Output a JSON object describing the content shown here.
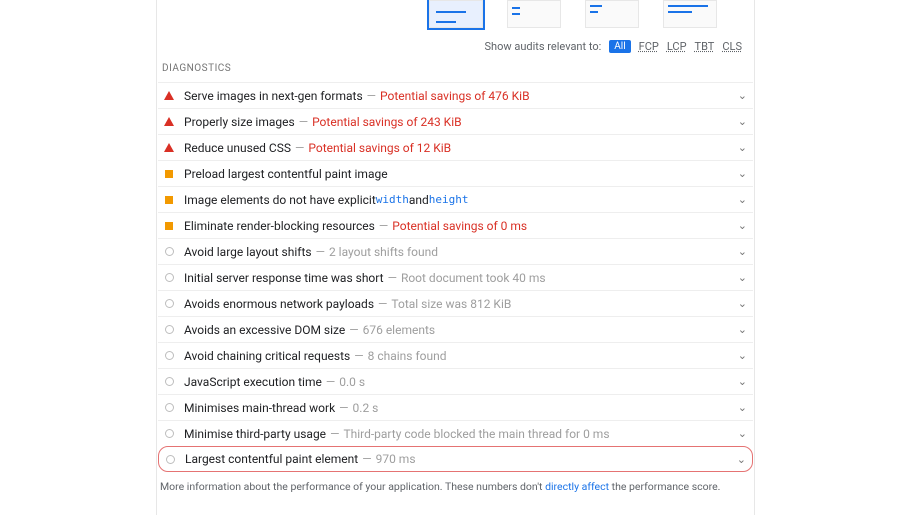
{
  "filters": {
    "label": "Show audits relevant to:",
    "all": "All",
    "items": [
      "FCP",
      "LCP",
      "TBT",
      "CLS"
    ]
  },
  "section_title": "DIAGNOSTICS",
  "rows": [
    {
      "icon": "tri",
      "title": "Serve images in next-gen formats",
      "detail": "Potential savings of 476 KiB",
      "detail_red": true
    },
    {
      "icon": "tri",
      "title": "Properly size images",
      "detail": "Potential savings of 243 KiB",
      "detail_red": true
    },
    {
      "icon": "tri",
      "title": "Reduce unused CSS",
      "detail": "Potential savings of 12 KiB",
      "detail_red": true
    },
    {
      "icon": "sq",
      "title": "Preload largest contentful paint image",
      "detail": ""
    },
    {
      "icon": "sq",
      "title": "Image elements do not have explicit ",
      "detail": "",
      "code": [
        "width",
        "height"
      ],
      "joiner": " and "
    },
    {
      "icon": "sq",
      "title": "Eliminate render-blocking resources",
      "detail": "Potential savings of 0 ms",
      "detail_red": true
    },
    {
      "icon": "circ",
      "title": "Avoid large layout shifts",
      "detail": "2 layout shifts found"
    },
    {
      "icon": "circ",
      "title": "Initial server response time was short",
      "detail": "Root document took 40 ms"
    },
    {
      "icon": "circ",
      "title": "Avoids enormous network payloads",
      "detail": "Total size was 812 KiB"
    },
    {
      "icon": "circ",
      "title": "Avoids an excessive DOM size",
      "detail": "676 elements"
    },
    {
      "icon": "circ",
      "title": "Avoid chaining critical requests",
      "detail": "8 chains found"
    },
    {
      "icon": "circ",
      "title": "JavaScript execution time",
      "detail": "0.0 s"
    },
    {
      "icon": "circ",
      "title": "Minimises main-thread work",
      "detail": "0.2 s"
    },
    {
      "icon": "circ",
      "title": "Minimise third-party usage",
      "detail": "Third-party code blocked the main thread for 0 ms"
    },
    {
      "icon": "circ",
      "title": "Largest contentful paint element",
      "detail": "970 ms",
      "highlight": true
    }
  ],
  "footer": {
    "pre": "More information about the performance of your application. These numbers don't ",
    "link": "directly affect",
    "post": " the performance score."
  }
}
